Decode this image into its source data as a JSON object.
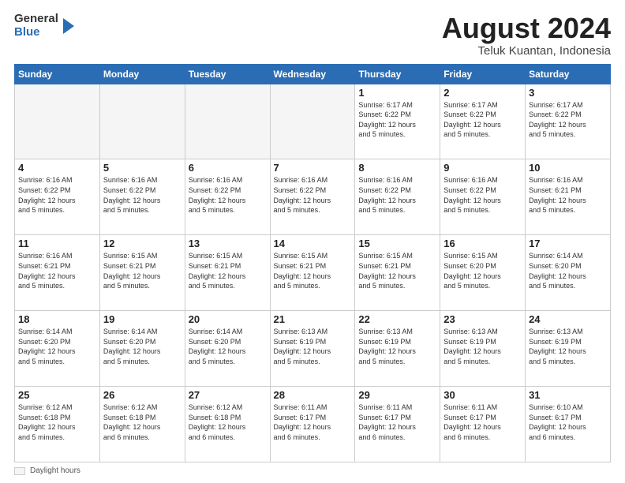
{
  "header": {
    "logo_general": "General",
    "logo_blue": "Blue",
    "month_year": "August 2024",
    "location": "Teluk Kuantan, Indonesia"
  },
  "days_of_week": [
    "Sunday",
    "Monday",
    "Tuesday",
    "Wednesday",
    "Thursday",
    "Friday",
    "Saturday"
  ],
  "weeks": [
    [
      {
        "day": "",
        "info": ""
      },
      {
        "day": "",
        "info": ""
      },
      {
        "day": "",
        "info": ""
      },
      {
        "day": "",
        "info": ""
      },
      {
        "day": "1",
        "info": "Sunrise: 6:17 AM\nSunset: 6:22 PM\nDaylight: 12 hours\nand 5 minutes."
      },
      {
        "day": "2",
        "info": "Sunrise: 6:17 AM\nSunset: 6:22 PM\nDaylight: 12 hours\nand 5 minutes."
      },
      {
        "day": "3",
        "info": "Sunrise: 6:17 AM\nSunset: 6:22 PM\nDaylight: 12 hours\nand 5 minutes."
      }
    ],
    [
      {
        "day": "4",
        "info": "Sunrise: 6:16 AM\nSunset: 6:22 PM\nDaylight: 12 hours\nand 5 minutes."
      },
      {
        "day": "5",
        "info": "Sunrise: 6:16 AM\nSunset: 6:22 PM\nDaylight: 12 hours\nand 5 minutes."
      },
      {
        "day": "6",
        "info": "Sunrise: 6:16 AM\nSunset: 6:22 PM\nDaylight: 12 hours\nand 5 minutes."
      },
      {
        "day": "7",
        "info": "Sunrise: 6:16 AM\nSunset: 6:22 PM\nDaylight: 12 hours\nand 5 minutes."
      },
      {
        "day": "8",
        "info": "Sunrise: 6:16 AM\nSunset: 6:22 PM\nDaylight: 12 hours\nand 5 minutes."
      },
      {
        "day": "9",
        "info": "Sunrise: 6:16 AM\nSunset: 6:22 PM\nDaylight: 12 hours\nand 5 minutes."
      },
      {
        "day": "10",
        "info": "Sunrise: 6:16 AM\nSunset: 6:21 PM\nDaylight: 12 hours\nand 5 minutes."
      }
    ],
    [
      {
        "day": "11",
        "info": "Sunrise: 6:16 AM\nSunset: 6:21 PM\nDaylight: 12 hours\nand 5 minutes."
      },
      {
        "day": "12",
        "info": "Sunrise: 6:15 AM\nSunset: 6:21 PM\nDaylight: 12 hours\nand 5 minutes."
      },
      {
        "day": "13",
        "info": "Sunrise: 6:15 AM\nSunset: 6:21 PM\nDaylight: 12 hours\nand 5 minutes."
      },
      {
        "day": "14",
        "info": "Sunrise: 6:15 AM\nSunset: 6:21 PM\nDaylight: 12 hours\nand 5 minutes."
      },
      {
        "day": "15",
        "info": "Sunrise: 6:15 AM\nSunset: 6:21 PM\nDaylight: 12 hours\nand 5 minutes."
      },
      {
        "day": "16",
        "info": "Sunrise: 6:15 AM\nSunset: 6:20 PM\nDaylight: 12 hours\nand 5 minutes."
      },
      {
        "day": "17",
        "info": "Sunrise: 6:14 AM\nSunset: 6:20 PM\nDaylight: 12 hours\nand 5 minutes."
      }
    ],
    [
      {
        "day": "18",
        "info": "Sunrise: 6:14 AM\nSunset: 6:20 PM\nDaylight: 12 hours\nand 5 minutes."
      },
      {
        "day": "19",
        "info": "Sunrise: 6:14 AM\nSunset: 6:20 PM\nDaylight: 12 hours\nand 5 minutes."
      },
      {
        "day": "20",
        "info": "Sunrise: 6:14 AM\nSunset: 6:20 PM\nDaylight: 12 hours\nand 5 minutes."
      },
      {
        "day": "21",
        "info": "Sunrise: 6:13 AM\nSunset: 6:19 PM\nDaylight: 12 hours\nand 5 minutes."
      },
      {
        "day": "22",
        "info": "Sunrise: 6:13 AM\nSunset: 6:19 PM\nDaylight: 12 hours\nand 5 minutes."
      },
      {
        "day": "23",
        "info": "Sunrise: 6:13 AM\nSunset: 6:19 PM\nDaylight: 12 hours\nand 5 minutes."
      },
      {
        "day": "24",
        "info": "Sunrise: 6:13 AM\nSunset: 6:19 PM\nDaylight: 12 hours\nand 5 minutes."
      }
    ],
    [
      {
        "day": "25",
        "info": "Sunrise: 6:12 AM\nSunset: 6:18 PM\nDaylight: 12 hours\nand 5 minutes."
      },
      {
        "day": "26",
        "info": "Sunrise: 6:12 AM\nSunset: 6:18 PM\nDaylight: 12 hours\nand 6 minutes."
      },
      {
        "day": "27",
        "info": "Sunrise: 6:12 AM\nSunset: 6:18 PM\nDaylight: 12 hours\nand 6 minutes."
      },
      {
        "day": "28",
        "info": "Sunrise: 6:11 AM\nSunset: 6:17 PM\nDaylight: 12 hours\nand 6 minutes."
      },
      {
        "day": "29",
        "info": "Sunrise: 6:11 AM\nSunset: 6:17 PM\nDaylight: 12 hours\nand 6 minutes."
      },
      {
        "day": "30",
        "info": "Sunrise: 6:11 AM\nSunset: 6:17 PM\nDaylight: 12 hours\nand 6 minutes."
      },
      {
        "day": "31",
        "info": "Sunrise: 6:10 AM\nSunset: 6:17 PM\nDaylight: 12 hours\nand 6 minutes."
      }
    ]
  ],
  "footer": {
    "daylight_label": "Daylight hours"
  }
}
